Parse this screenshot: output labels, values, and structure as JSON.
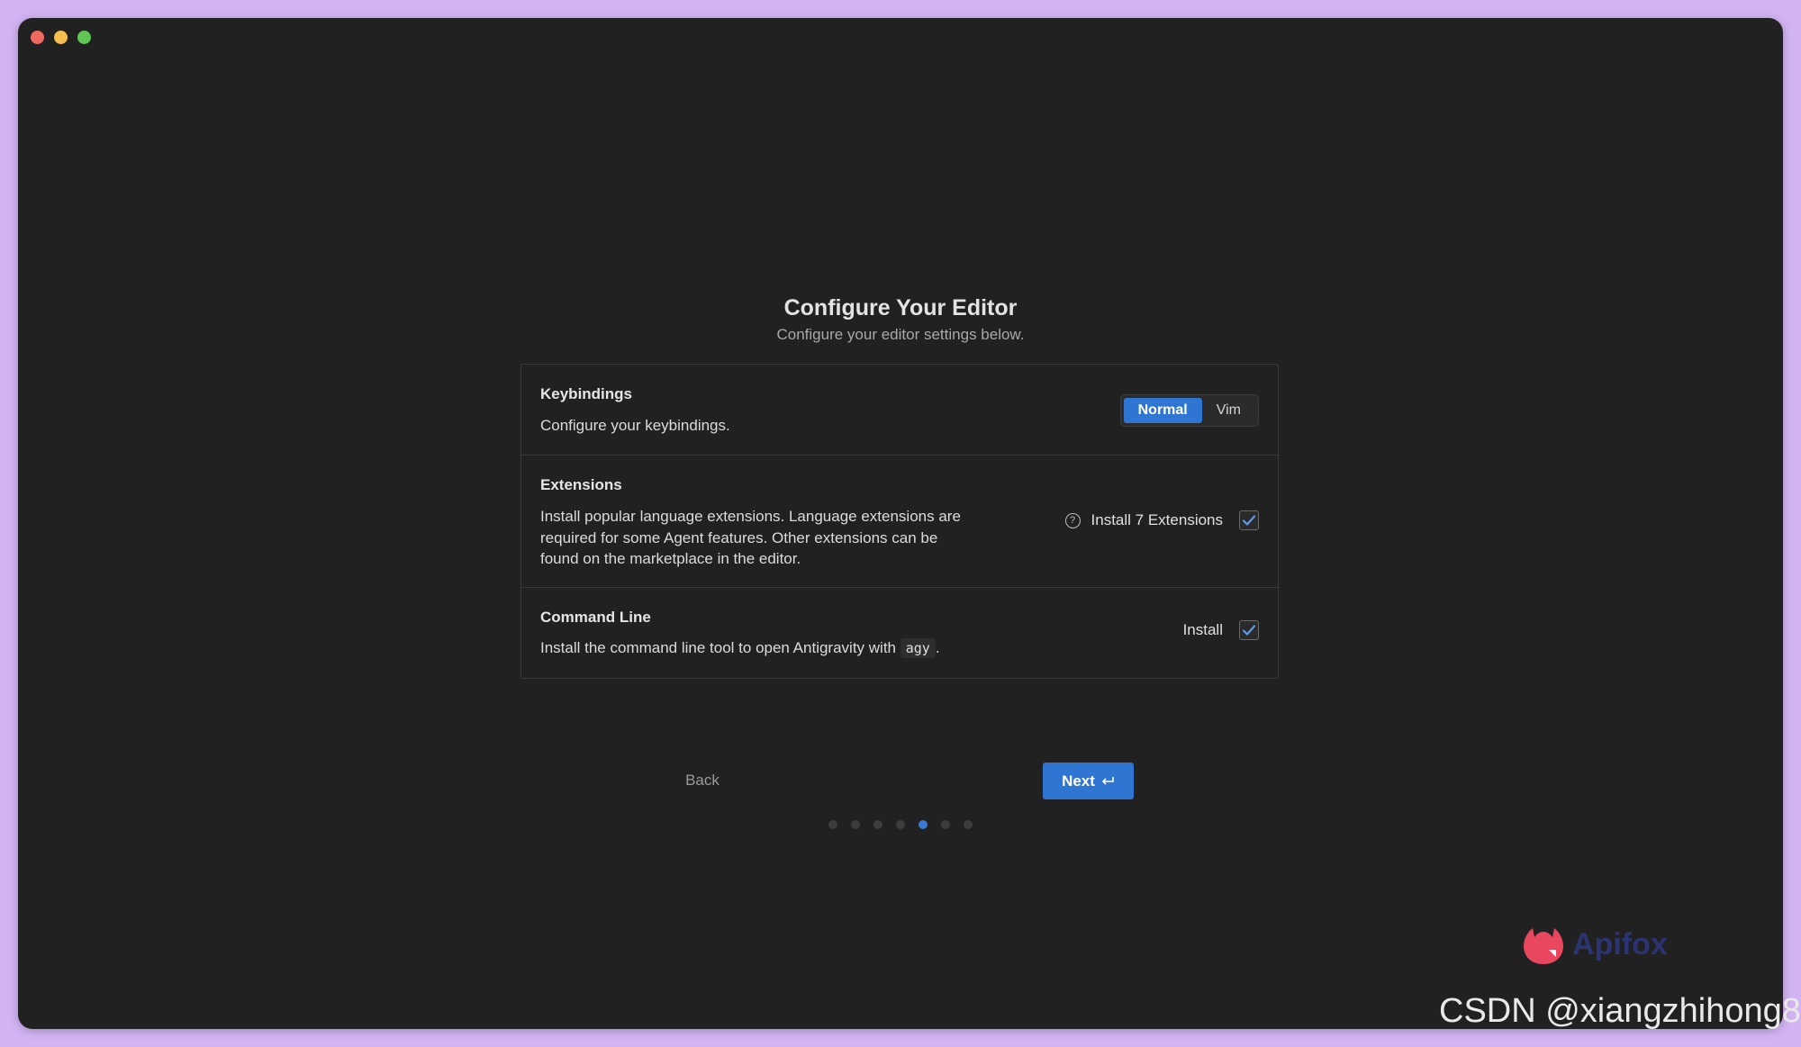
{
  "window": {
    "traffic_lights": [
      "close",
      "minimize",
      "maximize"
    ]
  },
  "header": {
    "title": "Configure Your Editor",
    "subtitle": "Configure your editor settings below."
  },
  "keybindings": {
    "title": "Keybindings",
    "description": "Configure your keybindings.",
    "options": [
      "Normal",
      "Vim"
    ],
    "selected": "Normal"
  },
  "extensions": {
    "title": "Extensions",
    "description": "Install popular language extensions. Language extensions are required for some Agent features. Other extensions can be found on the marketplace in the editor.",
    "help_icon": "question-circle-icon",
    "option_label": "Install 7 Extensions",
    "checked": true
  },
  "command_line": {
    "title": "Command Line",
    "description_prefix": "Install the command line tool to open Antigravity with",
    "command": "agy",
    "description_suffix": ".",
    "option_label": "Install",
    "checked": true
  },
  "footer": {
    "back_label": "Back",
    "next_label": "Next",
    "next_icon": "enter-key-icon",
    "step_count": 7,
    "current_step": 5
  },
  "watermarks": {
    "apifox": "Apifox",
    "csdn": "CSDN @xiangzhihong8"
  },
  "colors": {
    "accent": "#2f75d2",
    "background": "#212121",
    "frame": "#d2b4f3",
    "active_dot": "#3b78d1"
  }
}
